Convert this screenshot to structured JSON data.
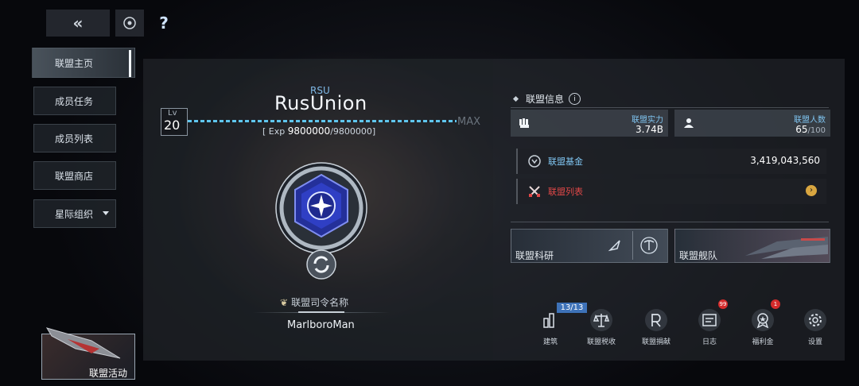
{
  "top": {
    "back_icon": "double-chevron-left-icon",
    "refresh_icon": "spin-circle-icon",
    "help_label": "?"
  },
  "sidebar": {
    "items": [
      {
        "label": "联盟主页",
        "active": true
      },
      {
        "label": "成员任务"
      },
      {
        "label": "成员列表"
      },
      {
        "label": "联盟商店"
      },
      {
        "label": "星际组织",
        "has_dropdown": true
      }
    ]
  },
  "alliance": {
    "tag": "RSU",
    "name": "RusUnion",
    "level_label": "Lv",
    "level": "20",
    "max_label": "MAX",
    "exp_prefix": "[ Exp ",
    "exp_current": "9800000",
    "exp_total": "/9800000]",
    "exp_progress": 1.0
  },
  "commander": {
    "label": "联盟司令名称",
    "name": "MarlboroMan"
  },
  "info": {
    "title": "联盟信息",
    "power_label": "联盟实力",
    "power_value": "3.74B",
    "members_label": "联盟人数",
    "members_value": "65",
    "members_max": "/100",
    "fund_label": "联盟基金",
    "fund_value": "3,419,043,560",
    "list_label": "联盟列表",
    "research_label": "联盟科研",
    "fleet_label": "联盟舰队"
  },
  "bottom": {
    "build_label": "建筑",
    "build_count": "13/13",
    "tax_label": "联盟税收",
    "donate_label": "联盟捐献",
    "log_label": "日志",
    "log_badge": "99",
    "welfare_label": "福利金",
    "welfare_badge": "1",
    "settings_label": "设置"
  },
  "activity": {
    "label": "联盟活动"
  },
  "colors": {
    "accent_blue": "#5fc6ee",
    "list_red": "#e04848",
    "badge_red": "#d52b2b"
  }
}
